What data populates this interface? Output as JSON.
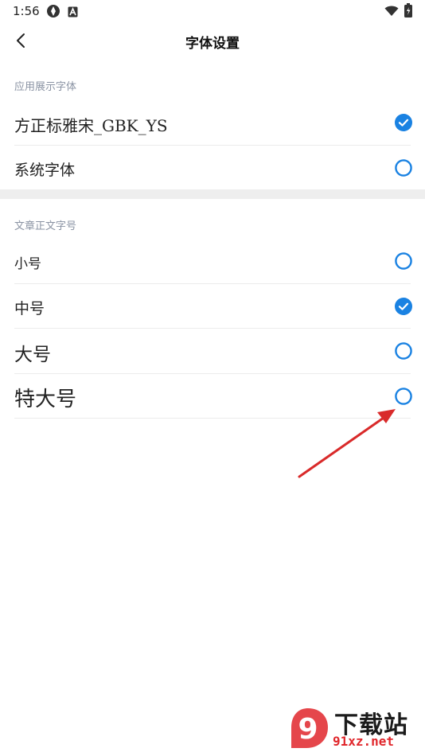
{
  "status_bar": {
    "time": "1:56",
    "icons": [
      "app-icon",
      "a-badge-icon",
      "wifi-icon",
      "battery-icon"
    ]
  },
  "header": {
    "title": "字体设置",
    "back_icon": "chevron-left-icon"
  },
  "display_font": {
    "section_label": "应用展示字体",
    "options": [
      {
        "label": "方正标雅宋_GBK_YS",
        "selected": true
      },
      {
        "label": "系统字体",
        "selected": false
      }
    ]
  },
  "body_size": {
    "section_label": "文章正文字号",
    "options": [
      {
        "label": "小号",
        "selected": false
      },
      {
        "label": "中号",
        "selected": true
      },
      {
        "label": "大号",
        "selected": false
      },
      {
        "label": "特大号",
        "selected": false
      }
    ]
  },
  "colors": {
    "accent": "#1a82e2",
    "annotation_arrow": "#d92a2a",
    "section_label": "#8a93a3"
  },
  "watermark": {
    "line1": "下载站",
    "line2": "91xz.net",
    "logo_glyph": "9"
  }
}
